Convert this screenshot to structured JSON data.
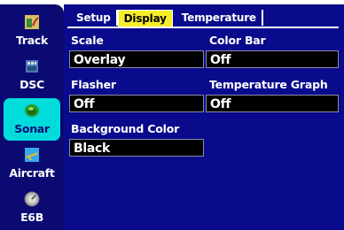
{
  "sidebar": {
    "items": [
      {
        "label": "Track",
        "icon": "track-icon"
      },
      {
        "label": "DSC",
        "icon": "dsc-icon"
      },
      {
        "label": "Sonar",
        "icon": "sonar-icon",
        "active": true
      },
      {
        "label": "Aircraft",
        "icon": "aircraft-icon"
      },
      {
        "label": "E6B",
        "icon": "e6b-icon"
      }
    ]
  },
  "tabs": [
    {
      "label": "Setup",
      "selected": false
    },
    {
      "label": "Display",
      "selected": true
    },
    {
      "label": "Temperature",
      "selected": false
    }
  ],
  "fields": {
    "scale": {
      "label": "Scale",
      "value": "Overlay"
    },
    "color_bar": {
      "label": "Color Bar",
      "value": "Off"
    },
    "flasher": {
      "label": "Flasher",
      "value": "Off"
    },
    "temperature_graph": {
      "label": "Temperature Graph",
      "value": "Off"
    },
    "background_color": {
      "label": "Background Color",
      "value": "Black"
    }
  },
  "colors": {
    "panel": "#0a0a8c",
    "sidebar": "#0a0a72",
    "active_item": "#00dcdc",
    "selected_tab": "#f6ee2a"
  }
}
